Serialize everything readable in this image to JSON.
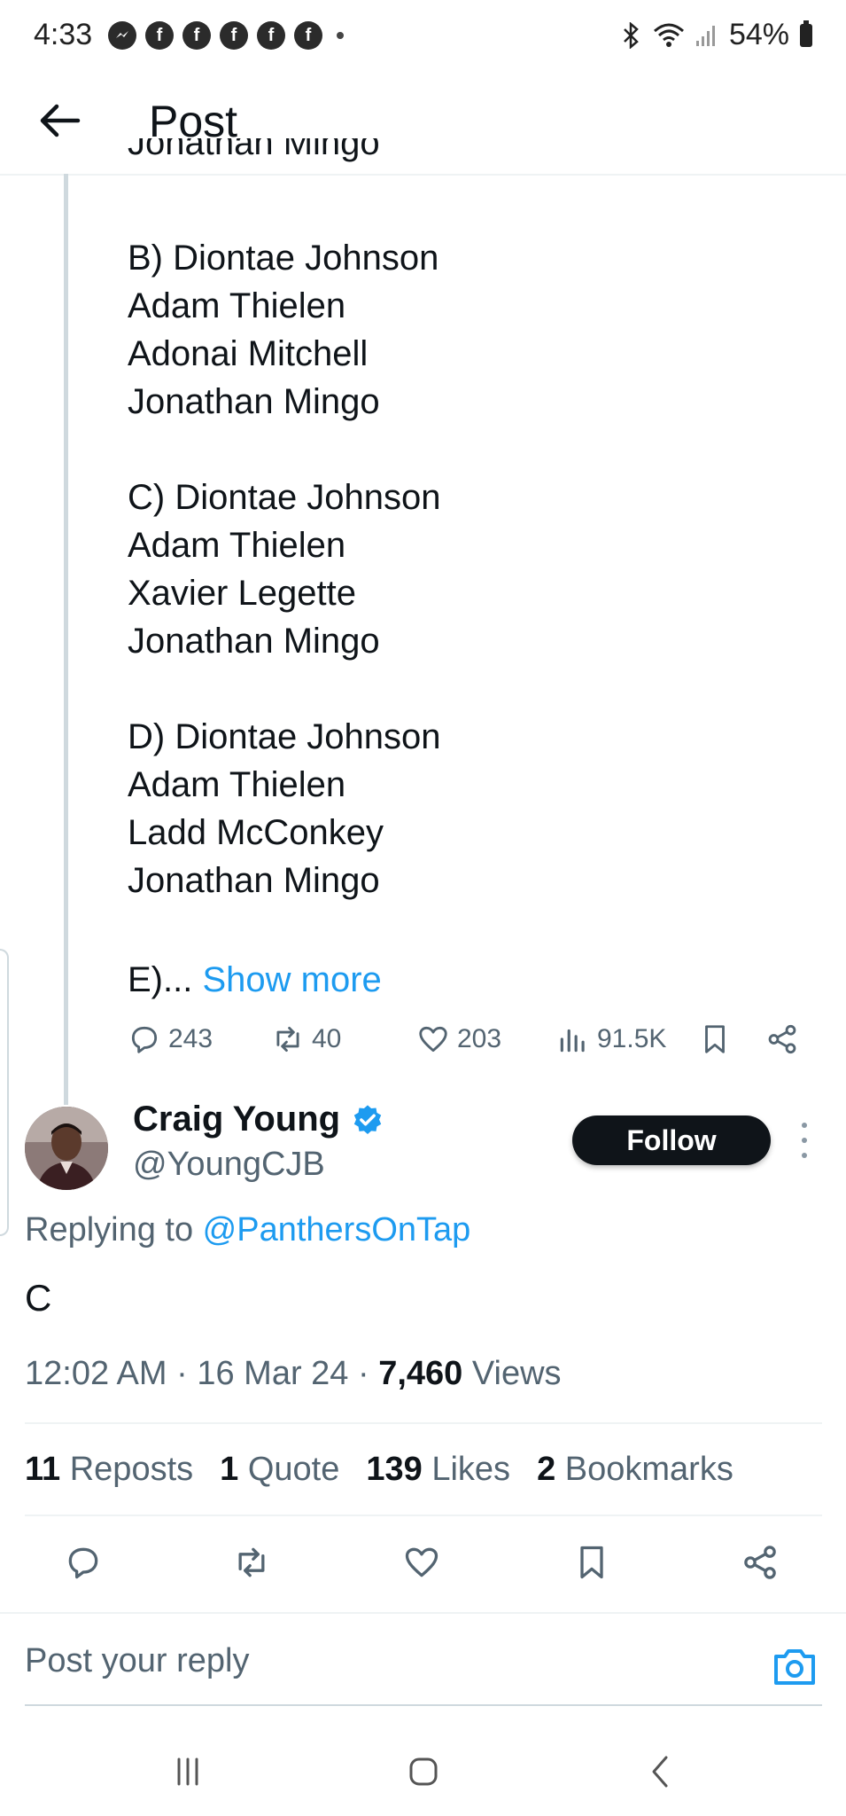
{
  "status_bar": {
    "time": "4:33",
    "notification_icons": [
      "messenger-icon",
      "facebook-icon",
      "facebook-icon",
      "facebook-icon",
      "facebook-icon",
      "facebook-icon"
    ],
    "battery": "54%"
  },
  "header": {
    "title": "Post"
  },
  "original_post": {
    "lines_above": "B) Diontae Johnson\nAdam Thielen\nAdonai Mitchell\nJonathan Mingo\n\nC) Diontae Johnson\nAdam Thielen\nXavier Legette\nJonathan Mingo\n\nD) Diontae Johnson\nAdam Thielen\nLadd McConkey\nJonathan Mingo",
    "truncated_prefix": "E)...",
    "show_more": "Show more",
    "partial_top_line": "Jonathan Mingo",
    "replies": "243",
    "reposts": "40",
    "likes": "203",
    "views": "91.5K"
  },
  "reply": {
    "name": "Craig Young",
    "handle": "@YoungCJB",
    "follow_label": "Follow",
    "replying_prefix": "Replying to ",
    "replying_to": "@PanthersOnTap",
    "text": "C",
    "time": "12:02 AM",
    "date": "16 Mar 24",
    "views_count": "7,460",
    "views_label": "Views",
    "stats": {
      "reposts_count": "11",
      "reposts_label": "Reposts",
      "quote_count": "1",
      "quote_label": "Quote",
      "likes_count": "139",
      "likes_label": "Likes",
      "bookmarks_count": "2",
      "bookmarks_label": "Bookmarks"
    }
  },
  "reply_bar": {
    "placeholder": "Post your reply"
  },
  "colors": {
    "accent": "#1d9bf0",
    "text": "#0f1419",
    "muted": "#536471",
    "verified": "#1d9bf0"
  }
}
